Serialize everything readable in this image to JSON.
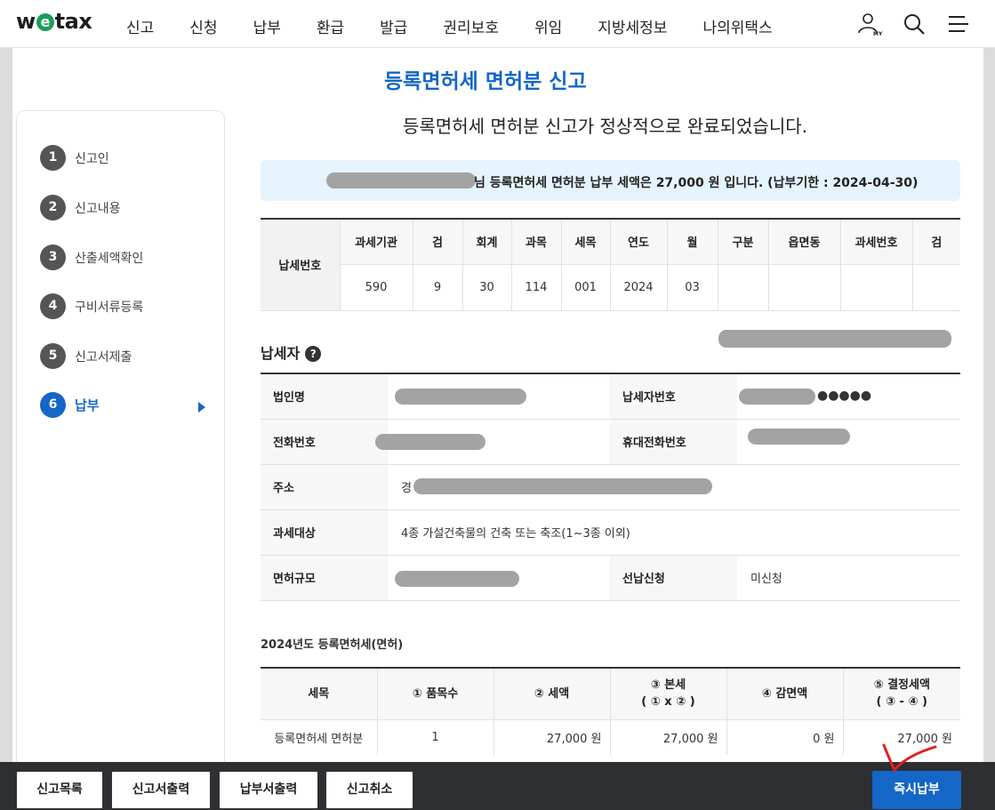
{
  "nav": {
    "logo": {
      "pre": "w",
      "e": "e",
      "post": "tax"
    },
    "menu": [
      "신고",
      "신청",
      "납부",
      "환급",
      "발급",
      "권리보호",
      "위임",
      "지방세정보",
      "나의위택스"
    ],
    "icons": [
      "my-user-icon",
      "search-icon",
      "menu-icon"
    ]
  },
  "page": {
    "title": "등록면허세 면허분 신고",
    "done_message": "등록면허세 면허분 신고가 정상적으로 완료되었습니다.",
    "notice": "님 등록면허세 면허분 납부 세액은 27,000 원 입니다. (납부기한 : 2024-04-30)"
  },
  "steps": [
    {
      "num": "1",
      "label": "신고인"
    },
    {
      "num": "2",
      "label": "신고내용"
    },
    {
      "num": "3",
      "label": "산출세액확인"
    },
    {
      "num": "4",
      "label": "구비서류등록"
    },
    {
      "num": "5",
      "label": "신고서제출"
    },
    {
      "num": "6",
      "label": "납부",
      "active": true
    }
  ],
  "tax_number": {
    "row_label": "납세번호",
    "headers": [
      "과세기관",
      "검",
      "회계",
      "과목",
      "세목",
      "연도",
      "월",
      "구분",
      "읍면동",
      "과세번호",
      "검"
    ],
    "values": [
      "590",
      "9",
      "30",
      "114",
      "001",
      "2024",
      "03",
      "",
      "",
      "",
      ""
    ]
  },
  "taxpayer": {
    "section_title": "납세자",
    "help_label": "?",
    "corp_name_label": "법인명",
    "payer_no_label": "납세자번호",
    "payer_no_mask": "●●●●●",
    "phone_label": "전화번호",
    "mobile_label": "휴대전화번호",
    "address_label": "주소",
    "address_prefix": "경",
    "target_label": "과세대상",
    "target_value": "4종 가설건축물의 건축 또는 축조(1~3종 이외)",
    "scale_label": "면허규모",
    "prepay_label": "선납신청",
    "prepay_value": "미신청"
  },
  "tax_table": {
    "title": "2024년도 등록면허세(면허)",
    "headers": [
      "세목",
      "① 품목수",
      "② 세액",
      "③ 본세\n( ① x ② )",
      "④ 감면액",
      "⑤ 결정세액\n( ③ - ④ )"
    ],
    "rows": [
      [
        "등록면허세 면허분",
        "1",
        "27,000 원",
        "27,000 원",
        "0 원",
        "27,000 원"
      ]
    ]
  },
  "actions": {
    "list": "신고목록",
    "print_report": "신고서출력",
    "print_payment": "납부서출력",
    "cancel": "신고취소",
    "pay_now": "즉시납부"
  },
  "colors": {
    "accent": "#1466c7",
    "notice_bg": "#e5f3fd",
    "bottom_bar": "#2d2f33",
    "annotation": "#e0201b"
  }
}
